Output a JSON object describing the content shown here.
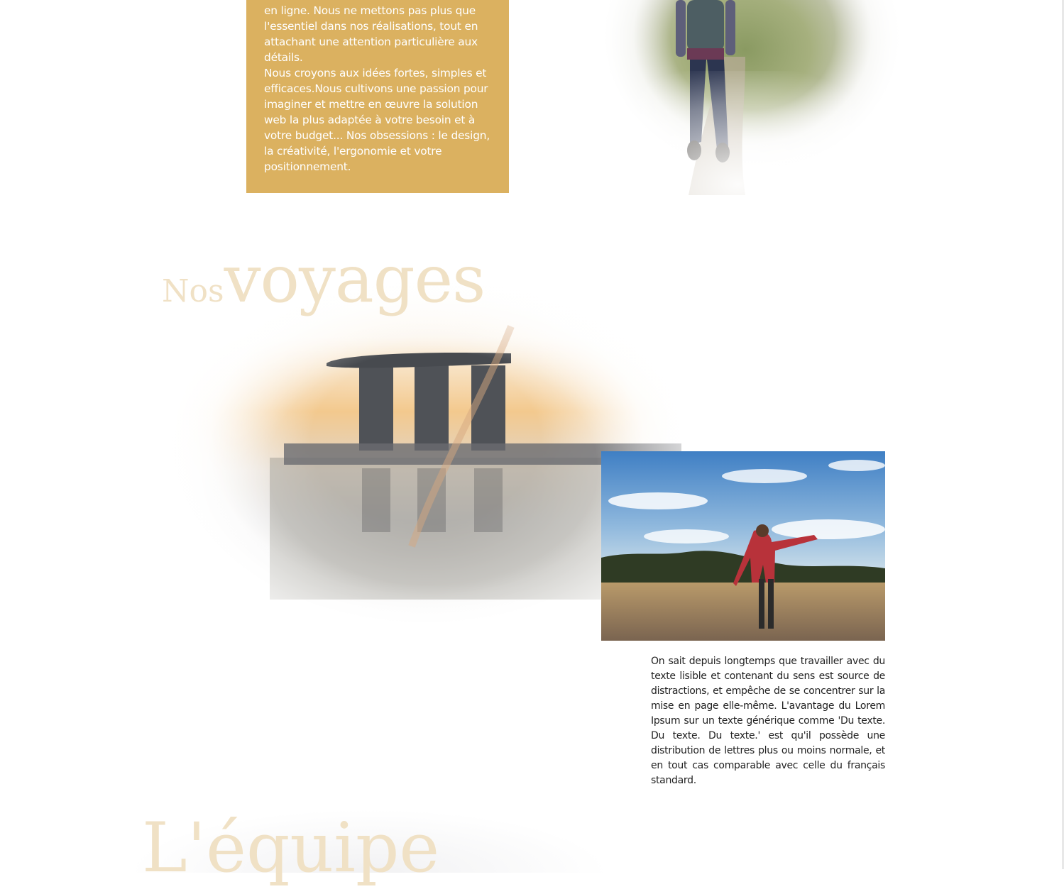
{
  "about": {
    "paragraph_1": "en ligne. Nous ne mettons pas plus que l'essentiel dans nos réalisations, tout en attachant une attention particulière aux détails.",
    "paragraph_2": "Nous croyons aux idées fortes, simples et efficaces.Nous cultivons une passion pour imaginer et mettre en œuvre la solution web la plus adaptée à votre besoin et à votre budget... Nos obsessions : le design, la créativité, l'ergonomie et votre positionnement."
  },
  "voyages": {
    "heading_small": "Nos",
    "heading_big": "voyages",
    "description": "On sait depuis longtemps que travailler avec du texte lisible et contenant du sens est source de distractions, et empêche de se concentrer sur la mise en page elle-même. L'avantage du Lorem Ipsum sur un texte générique comme 'Du texte. Du texte. Du texte.' est qu'il possède une distribution de lettres plus ou moins normale, et en tout cas comparable avec celle du français standard."
  },
  "equipe": {
    "heading": "L'équipe"
  },
  "colors": {
    "accent_gold": "#dbb160",
    "heading_beige": "#f0e1c5",
    "body_text": "#222222"
  }
}
